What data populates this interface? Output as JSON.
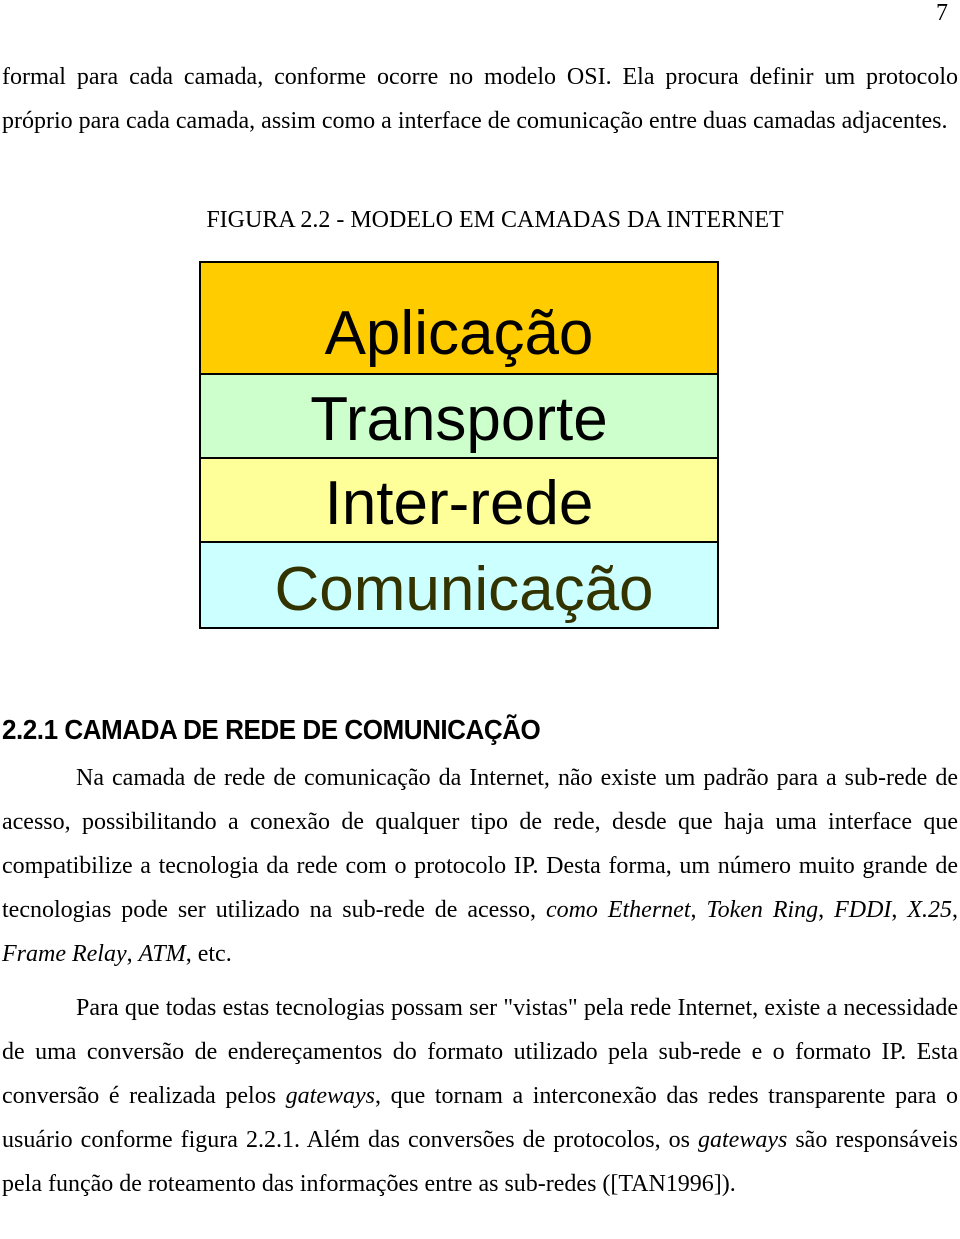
{
  "page_number": "7",
  "intro_paragraph": {
    "text": "formal para cada camada, conforme ocorre no modelo OSI. Ela procura definir um protocolo próprio para cada camada, assim como a interface de comunicação entre duas camadas adjacentes."
  },
  "figure": {
    "caption": "FIGURA 2.2 - MODELO EM CAMADAS DA INTERNET",
    "layers": [
      {
        "label": "Aplicação",
        "color": "#FFCC00"
      },
      {
        "label": "Transporte",
        "color": "#CCFFCC"
      },
      {
        "label": "Inter-rede",
        "color": "#FFFF99"
      },
      {
        "label": "Comunicação",
        "color": "#CCFFFF"
      }
    ]
  },
  "section": {
    "heading": "2.2.1 CAMADA DE REDE DE COMUNICAÇÃO",
    "paragraph1": {
      "text_a": "Na camada de rede de comunicação da Internet, não existe um padrão para a sub-rede de acesso, possibilitando a conexão de qualquer tipo de rede, desde que haja uma interface que compatibilize a tecnologia da rede com o protocolo IP. Desta forma, um número muito grande de tecnologias pode ser utilizado na sub-rede de acesso, ",
      "italic_a": "como Ethernet",
      "sep1": ", ",
      "italic_b": "Token Ring",
      "sep2": ", ",
      "italic_c": "FDDI",
      "sep3": ", ",
      "italic_d": "X.25",
      "sep4": ", ",
      "italic_e": "Frame Relay",
      "sep5": ", ",
      "italic_f": "ATM",
      "text_end": ", etc."
    },
    "paragraph2": {
      "text_a": "Para que todas estas tecnologias possam ser \"vistas\" pela rede Internet, existe a necessidade de uma conversão de endereçamentos do formato utilizado pela sub-rede e o formato IP. Esta conversão é realizada pelos ",
      "italic_a": "gateways",
      "text_b": ", que tornam a interconexão das redes transparente para o usuário conforme figura 2.2.1. Além das conversões de protocolos, os ",
      "italic_b": "gateways",
      "text_c": " são responsáveis pela função de roteamento das informações entre as sub-redes ([TAN1996])."
    }
  }
}
